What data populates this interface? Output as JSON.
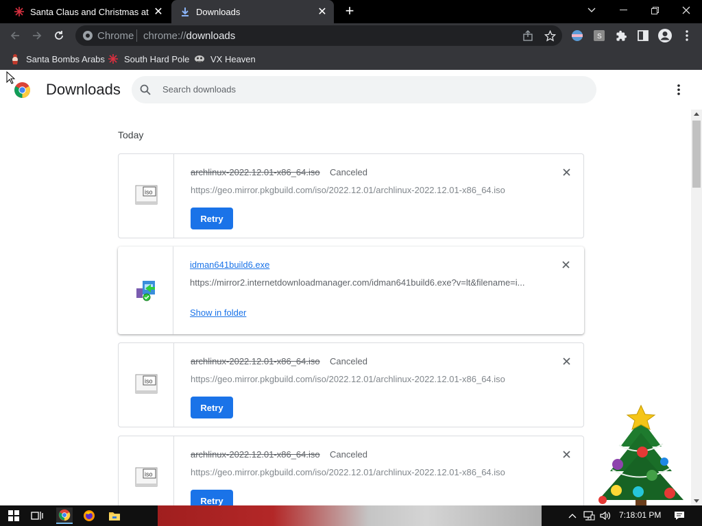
{
  "tabs": [
    {
      "title": "Santa Claus and Christmas at the",
      "active": false,
      "icon": "snowflake-favicon-icon"
    },
    {
      "title": "Downloads",
      "active": true,
      "icon": "download-favicon-icon"
    }
  ],
  "omnibox": {
    "chip": "Chrome",
    "scheme": "chrome://",
    "path": "downloads"
  },
  "bookmarks": [
    {
      "label": "Santa Bombs Arabs",
      "icon": "santa-favicon-icon"
    },
    {
      "label": "South Hard Pole",
      "icon": "snowflake-favicon-icon"
    },
    {
      "label": "VX Heaven",
      "icon": "vx-heaven-favicon-icon"
    }
  ],
  "page": {
    "title": "Downloads",
    "search_placeholder": "Search downloads",
    "section_date": "Today"
  },
  "downloads": [
    {
      "filename": "archlinux-2022.12.01-x86_64.iso",
      "status": "Canceled",
      "url": "https://geo.mirror.pkgbuild.com/iso/2022.12.01/archlinux-2022.12.01-x86_64.iso",
      "action": "Retry"
    },
    {
      "filename": "idman641build6.exe",
      "status": "",
      "url": "https://mirror2.internetdownloadmanager.com/idman641build6.exe?v=lt&filename=i...",
      "action": "Show in folder"
    },
    {
      "filename": "archlinux-2022.12.01-x86_64.iso",
      "status": "Canceled",
      "url": "https://geo.mirror.pkgbuild.com/iso/2022.12.01/archlinux-2022.12.01-x86_64.iso",
      "action": "Retry"
    },
    {
      "filename": "archlinux-2022.12.01-x86_64.iso",
      "status": "Canceled",
      "url": "https://geo.mirror.pkgbuild.com/iso/2022.12.01/archlinux-2022.12.01-x86_64.iso",
      "action": "Retry"
    }
  ],
  "taskbar": {
    "clock": "7:18:01 PM"
  },
  "colors": {
    "accent": "#1a73e8",
    "tab_bar": "#000000",
    "toolbar": "#35363a",
    "omnibox": "#202124"
  }
}
